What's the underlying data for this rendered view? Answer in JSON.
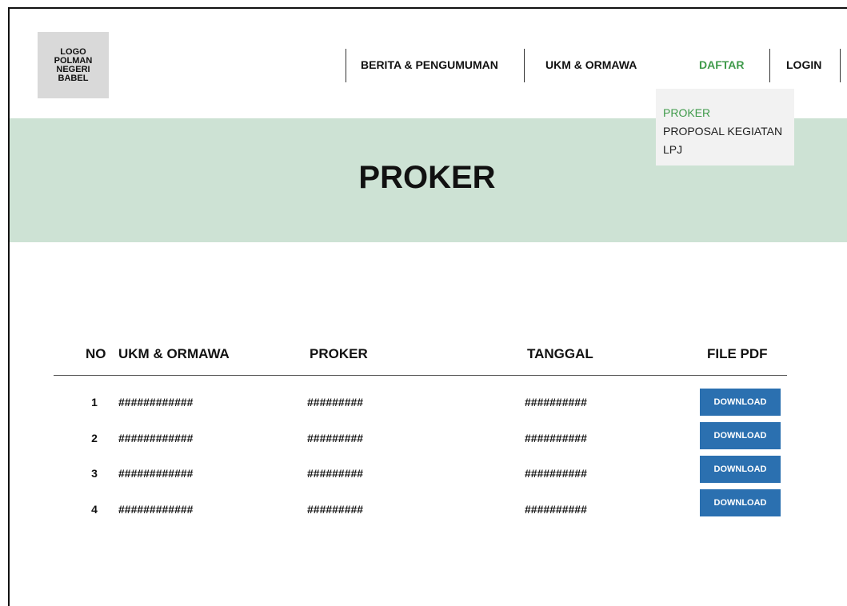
{
  "logo": {
    "lines": [
      "LOGO",
      "POLMAN",
      "NEGERI",
      "BABEL"
    ]
  },
  "nav": {
    "items": [
      {
        "label": "BERITA & PENGUMUMAN"
      },
      {
        "label": "UKM & ORMAWA"
      },
      {
        "label": "DAFTAR",
        "active": true
      },
      {
        "label": "LOGIN"
      }
    ],
    "accent_color": "#3f9a4a"
  },
  "dropdown": {
    "items": [
      {
        "label": "PROKER",
        "active": true
      },
      {
        "label": "PROPOSAL KEGIATAN"
      },
      {
        "label": "LPJ"
      }
    ]
  },
  "hero": {
    "title": "PROKER",
    "background_color": "#cde2d4"
  },
  "table": {
    "headers": [
      "NO",
      "UKM & ORMAWA",
      "PROKER",
      "TANGGAL",
      "FILE PDF"
    ],
    "rows": [
      {
        "no": "1",
        "ukm": "############",
        "proker": "#########",
        "tanggal": "##########",
        "file_label": "DOWNLOAD"
      },
      {
        "no": "2",
        "ukm": "############",
        "proker": "#########",
        "tanggal": "##########",
        "file_label": "DOWNLOAD"
      },
      {
        "no": "3",
        "ukm": "############",
        "proker": "#########",
        "tanggal": "##########",
        "file_label": "DOWNLOAD"
      },
      {
        "no": "4",
        "ukm": "############",
        "proker": "#########",
        "tanggal": "##########",
        "file_label": "DOWNLOAD"
      }
    ],
    "button_color": "#2b70b0"
  }
}
